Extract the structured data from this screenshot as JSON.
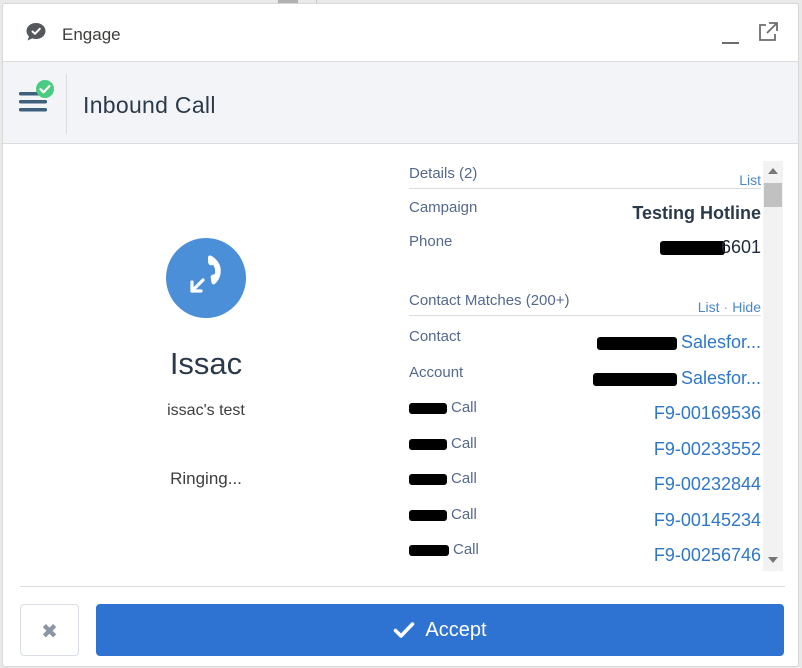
{
  "window": {
    "title": "Engage",
    "icons": {
      "app": "chat-bubble-icon",
      "minimize": "minimize-icon",
      "popout": "popout-icon"
    }
  },
  "header": {
    "title": "Inbound Call",
    "menu_icon": "menu-icon",
    "status_icon": "check-circle-icon",
    "status_color": "#4bca81"
  },
  "caller": {
    "icon": "incoming-call-icon",
    "name": "Issac",
    "subtitle": "issac's test",
    "status": "Ringing..."
  },
  "details": {
    "title": "Details (2)",
    "link": "List",
    "rows": [
      {
        "label": "Campaign",
        "value": "Testing Hotline"
      },
      {
        "label": "Phone",
        "value": "6601"
      }
    ]
  },
  "contact_matches": {
    "title": "Contact Matches (200+)",
    "links": [
      "List",
      "Hide"
    ],
    "rows": [
      {
        "label": "Contact",
        "value": "Salesfor..."
      },
      {
        "label": "Account",
        "value": "Salesfor..."
      }
    ],
    "calls": [
      {
        "label": "Call",
        "value": "F9-00169536"
      },
      {
        "label": "Call",
        "value": "F9-00233552"
      },
      {
        "label": "Call",
        "value": "F9-00232844"
      },
      {
        "label": "Call",
        "value": "F9-00145234"
      },
      {
        "label": "Call",
        "value": "F9-00256746"
      }
    ]
  },
  "footer": {
    "reject_icon": "close-icon",
    "accept_icon": "checkmark-icon",
    "accept_label": "Accept",
    "accept_color": "#2f73d2"
  }
}
